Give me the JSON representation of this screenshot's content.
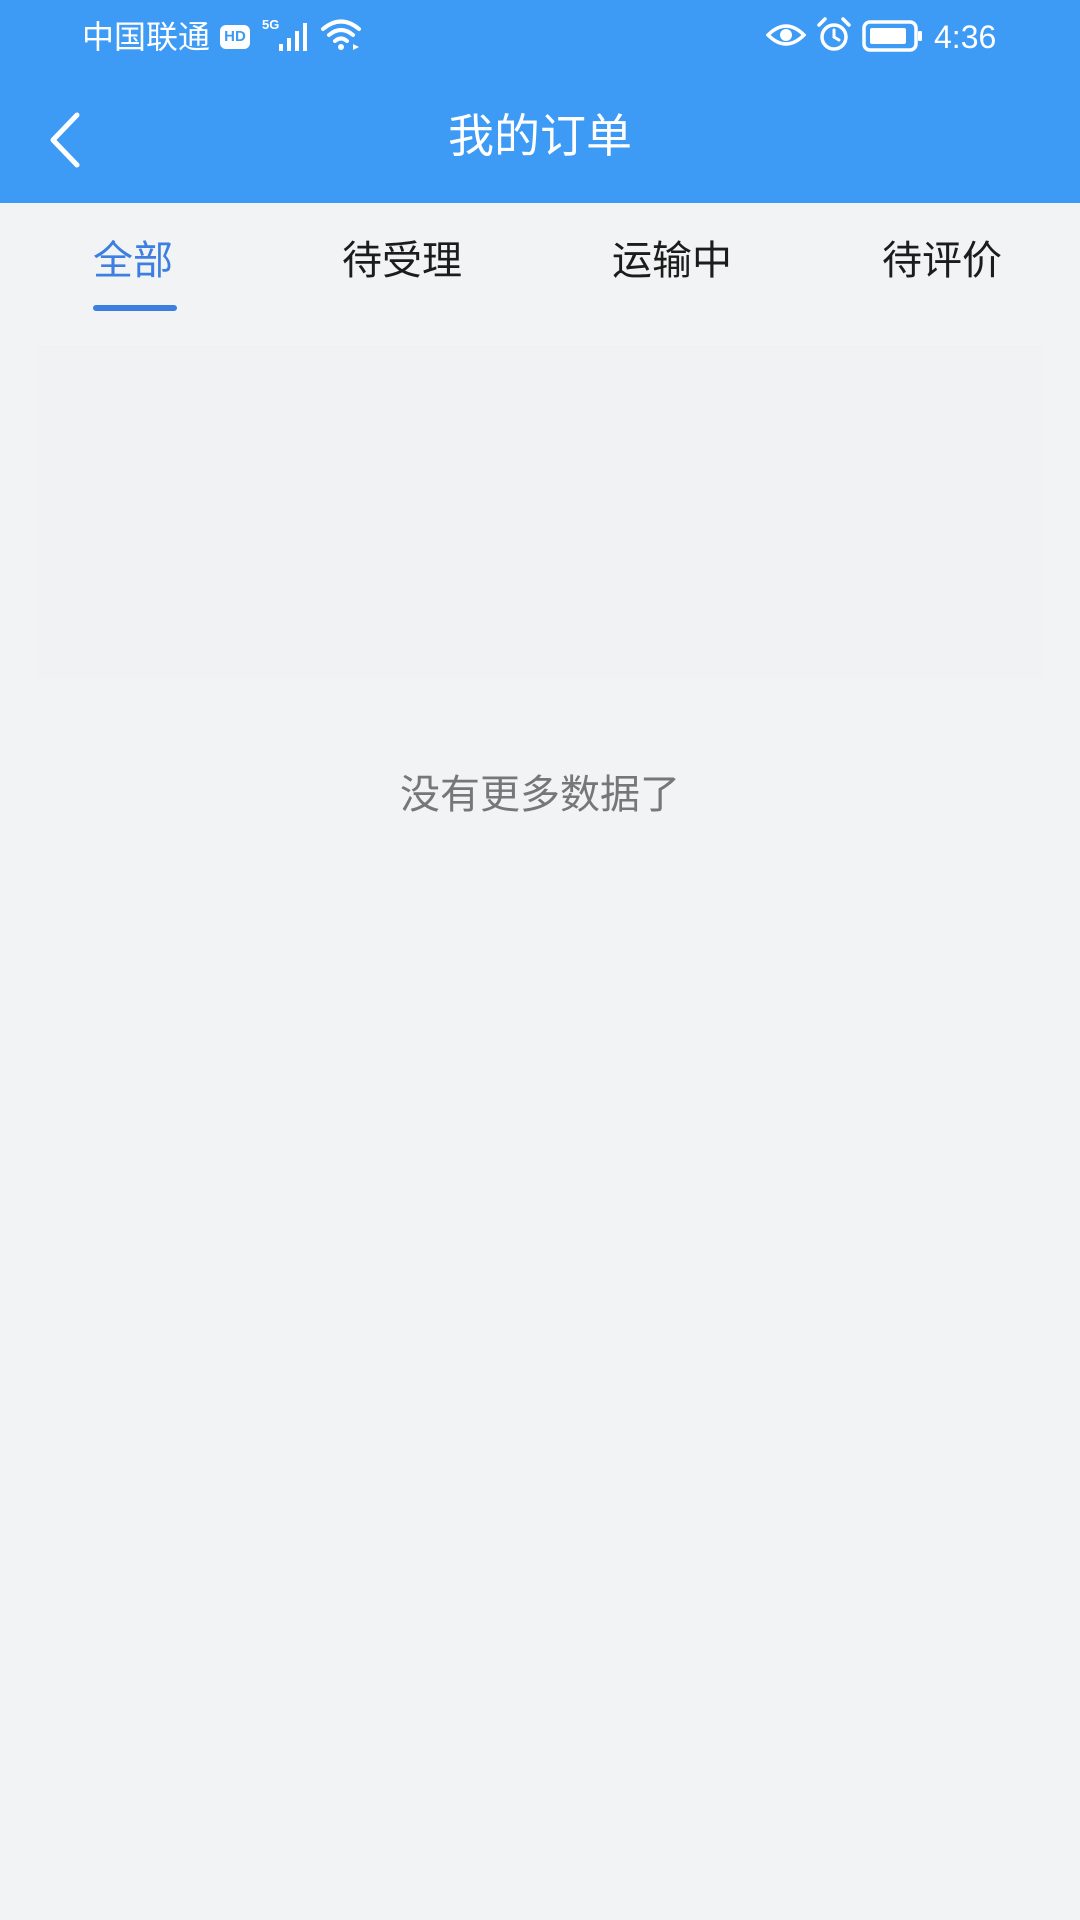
{
  "status_bar": {
    "carrier": "中国联通",
    "hd_badge": "HD",
    "network_type": "5G",
    "time": "4:36",
    "icons": [
      "hd-icon",
      "signal-icon",
      "wifi-icon",
      "eye-icon",
      "alarm-icon",
      "battery-icon"
    ]
  },
  "header": {
    "title": "我的订单",
    "back_icon": "chevron-left-icon"
  },
  "tabs": {
    "items": [
      {
        "label": "全部",
        "active": true
      },
      {
        "label": "待受理",
        "active": false
      },
      {
        "label": "运输中",
        "active": false
      },
      {
        "label": "待评价",
        "active": false
      }
    ]
  },
  "list": {
    "empty_message": "没有更多数据了"
  },
  "colors": {
    "header_background": "#3d9bf6",
    "tab_active": "#3c7fe0",
    "page_background": "#f2f3f4",
    "empty_text": "#777777"
  }
}
